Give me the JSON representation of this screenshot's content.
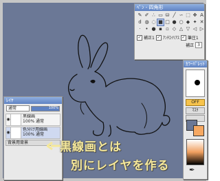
{
  "tools": {
    "title": "ﾍﾟﾝ - 四角形",
    "checkbox_1": "補正1",
    "checkbox_2": "ｱﾝﾁｴｲﾘｱｽ",
    "checkbox_3": "筆圧1",
    "label_correction": "補正",
    "correction_value": "3"
  },
  "color": {
    "title": "ｶﾗｰﾊﾟﾚｯﾄ",
    "off_label": "OFF",
    "button_1": "ﾏｽｸ",
    "button_2": "",
    "fg_color": "#6b7896",
    "bg_color": "#f6a862"
  },
  "layers": {
    "title": "ﾚｲﾔ",
    "blend_mode": "通常",
    "opacity": "100%",
    "items": [
      {
        "name": "黒線画",
        "info": "100% 通常"
      },
      {
        "name": "色分け用線画",
        "info": "100% 通常"
      }
    ],
    "folder": "背景用背景"
  },
  "annotation": {
    "line1": "黒線画とは",
    "line2": "別にレイヤを作る"
  }
}
